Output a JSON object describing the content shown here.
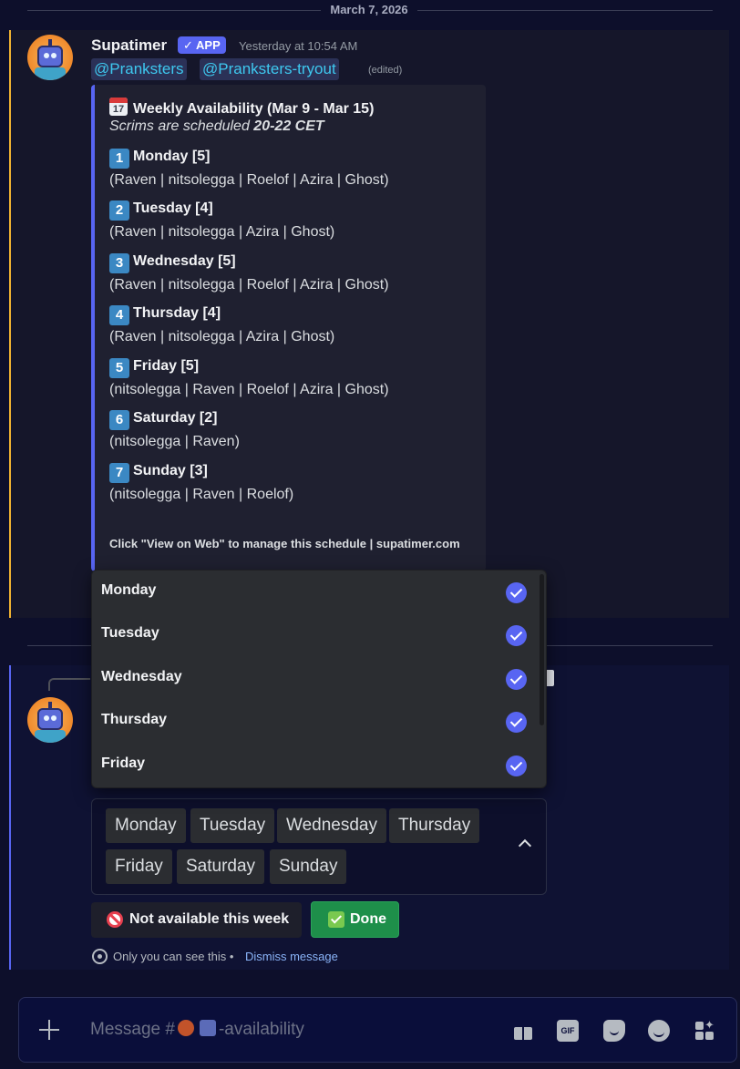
{
  "date_divider": "March 7, 2026",
  "message1": {
    "username": "Supatimer",
    "app_tag": "APP",
    "timestamp": "Yesterday at 10:54 AM",
    "mentions": [
      "@Pranksters",
      "@Pranksters-tryout"
    ],
    "edited": "(edited)",
    "embed": {
      "calendar_emoji_label": "17",
      "title": "Weekly Availability (Mar 9 - Mar 15)",
      "subtitle_prefix": "Scrims are scheduled ",
      "subtitle_time": "20-22 CET",
      "days": [
        {
          "num": "1",
          "head": "Monday [5]",
          "names": "(Raven | nitsolegga | Roelof | Azira | Ghost)"
        },
        {
          "num": "2",
          "head": "Tuesday [4]",
          "names": "(Raven | nitsolegga | Azira | Ghost)"
        },
        {
          "num": "3",
          "head": "Wednesday [5]",
          "names": "(Raven | nitsolegga | Roelof | Azira | Ghost)"
        },
        {
          "num": "4",
          "head": "Thursday [4]",
          "names": "(Raven | nitsolegga | Azira | Ghost)"
        },
        {
          "num": "5",
          "head": "Friday [5]",
          "names": "(nitsolegga | Raven | Roelof | Azira | Ghost)"
        },
        {
          "num": "6",
          "head": "Saturday [2]",
          "names": "(nitsolegga | Raven)"
        },
        {
          "num": "7",
          "head": "Sunday [3]",
          "names": "(nitsolegga | Raven | Roelof)"
        }
      ],
      "footer": "Click \"View on Web\" to manage this schedule | supatimer.com"
    }
  },
  "dropdown": {
    "options": [
      {
        "label": "Monday",
        "checked": true
      },
      {
        "label": "Tuesday",
        "checked": true
      },
      {
        "label": "Wednesday",
        "checked": true
      },
      {
        "label": "Thursday",
        "checked": true
      },
      {
        "label": "Friday",
        "checked": true
      }
    ]
  },
  "select": {
    "selected": [
      "Monday",
      "Tuesday",
      "Wednesday",
      "Thursday",
      "Friday",
      "Saturday",
      "Sunday"
    ]
  },
  "buttons": {
    "not_available": "Not available this week",
    "done": "Done"
  },
  "ephemeral": {
    "text": "Only you can see this •",
    "dismiss": "Dismiss message"
  },
  "composer": {
    "placeholder_prefix": "Message #",
    "placeholder_suffix": "-availability",
    "tools": [
      "gift-icon",
      "gif-icon",
      "sticker-icon",
      "emoji-icon",
      "apps-icon"
    ],
    "gif_label": "GIF"
  },
  "colors": {
    "accent": "#5865f2",
    "mention": "#3ec8ef",
    "done": "#1e8f4a",
    "highlight_bar": "#f0b232"
  }
}
